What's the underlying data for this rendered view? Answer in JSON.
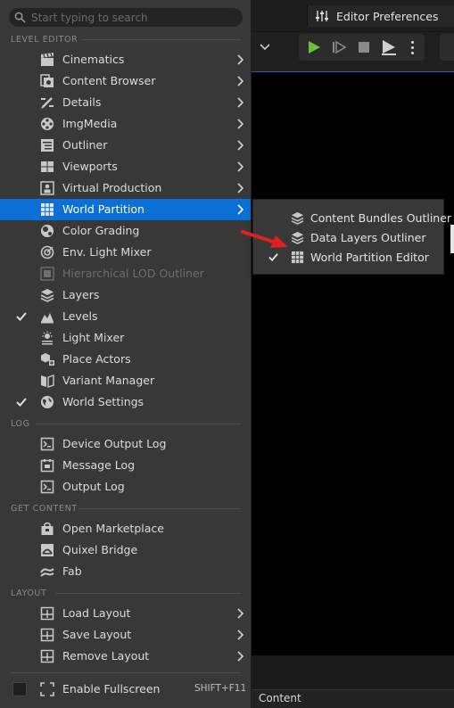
{
  "background": {
    "editor_preferences_label": "Editor Preferences",
    "bottom_tab_label": "Content"
  },
  "menu": {
    "search_placeholder": "Start typing to search",
    "sections": {
      "level_editor": "LEVEL EDITOR",
      "log": "LOG",
      "get_content": "GET CONTENT",
      "layout": "LAYOUT"
    },
    "level_editor_items": [
      {
        "label": "Cinematics",
        "icon": "cinematics-icon",
        "submenu": true
      },
      {
        "label": "Content Browser",
        "icon": "content-browser-icon",
        "submenu": true
      },
      {
        "label": "Details",
        "icon": "details-icon",
        "submenu": true
      },
      {
        "label": "ImgMedia",
        "icon": "imgmedia-icon",
        "submenu": true
      },
      {
        "label": "Outliner",
        "icon": "outliner-icon",
        "submenu": true
      },
      {
        "label": "Viewports",
        "icon": "viewports-icon",
        "submenu": true
      },
      {
        "label": "Virtual Production",
        "icon": "virtual-production-icon",
        "submenu": true
      },
      {
        "label": "World Partition",
        "icon": "world-partition-icon",
        "submenu": true,
        "highlighted": true
      },
      {
        "label": "Color Grading",
        "icon": "color-grading-icon"
      },
      {
        "label": "Env. Light Mixer",
        "icon": "env-light-mixer-icon"
      },
      {
        "label": "Hierarchical LOD Outliner",
        "icon": "hlod-outliner-icon",
        "disabled": true
      },
      {
        "label": "Layers",
        "icon": "layers-icon"
      },
      {
        "label": "Levels",
        "icon": "levels-icon",
        "checked": true
      },
      {
        "label": "Light Mixer",
        "icon": "light-mixer-icon"
      },
      {
        "label": "Place Actors",
        "icon": "place-actors-icon"
      },
      {
        "label": "Variant Manager",
        "icon": "variant-manager-icon"
      },
      {
        "label": "World Settings",
        "icon": "world-settings-icon",
        "checked": true
      }
    ],
    "log_items": [
      {
        "label": "Device Output Log",
        "icon": "device-output-log-icon"
      },
      {
        "label": "Message Log",
        "icon": "message-log-icon"
      },
      {
        "label": "Output Log",
        "icon": "output-log-icon"
      }
    ],
    "get_content_items": [
      {
        "label": "Open Marketplace",
        "icon": "marketplace-icon"
      },
      {
        "label": "Quixel Bridge",
        "icon": "quixel-bridge-icon"
      },
      {
        "label": "Fab",
        "icon": "fab-icon"
      }
    ],
    "layout_items": [
      {
        "label": "Load Layout",
        "icon": "load-layout-icon",
        "submenu": true
      },
      {
        "label": "Save Layout",
        "icon": "save-layout-icon",
        "submenu": true
      },
      {
        "label": "Remove Layout",
        "icon": "remove-layout-icon",
        "submenu": true
      }
    ],
    "fullscreen": {
      "label": "Enable Fullscreen",
      "shortcut": "SHIFT+F11",
      "checked": false
    }
  },
  "submenu": {
    "items": [
      {
        "label": "Content Bundles Outliner",
        "icon": "content-bundles-icon"
      },
      {
        "label": "Data Layers Outliner",
        "icon": "data-layers-icon"
      },
      {
        "label": "World Partition Editor",
        "icon": "world-partition-editor-icon",
        "checked": true
      }
    ]
  },
  "colors": {
    "menu_bg": "#383838",
    "highlight": "#0a6fd6",
    "play_green": "#6fbf3a",
    "annotation_red": "#e02020"
  }
}
